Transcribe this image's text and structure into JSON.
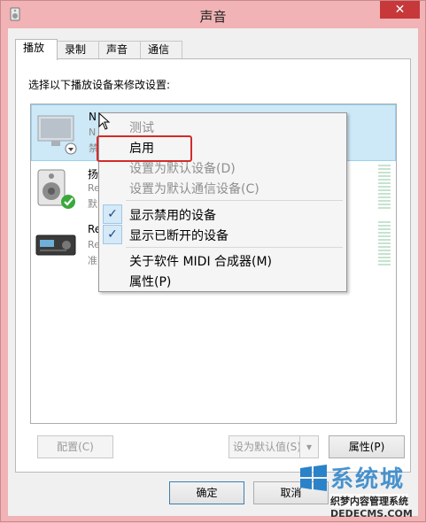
{
  "window": {
    "title": "声音",
    "close_label": "✕"
  },
  "tabs": [
    {
      "label": "播放",
      "active": true
    },
    {
      "label": "录制",
      "active": false
    },
    {
      "label": "声音",
      "active": false
    },
    {
      "label": "通信",
      "active": false
    }
  ],
  "instruction": "选择以下播放设备来修改设置:",
  "devices": [
    {
      "name": "N",
      "line2": "N",
      "line3": "禁",
      "icon": "monitor-icon",
      "status": "disabled"
    },
    {
      "name": "扬",
      "line2": "Re",
      "line3": "默",
      "icon": "speaker-icon",
      "status": "default"
    },
    {
      "name": "Re",
      "line2": "Re",
      "line3": "准",
      "icon": "receiver-icon",
      "status": "ready"
    }
  ],
  "context_menu": {
    "items": [
      {
        "label": "测试",
        "disabled": true,
        "checked": false
      },
      {
        "label": "启用",
        "disabled": false,
        "checked": false
      },
      {
        "label": "设置为默认设备(D)",
        "disabled": true,
        "checked": false
      },
      {
        "label": "设置为默认通信设备(C)",
        "disabled": true,
        "checked": false
      },
      {
        "label": "显示禁用的设备",
        "disabled": false,
        "checked": true
      },
      {
        "label": "显示已断开的设备",
        "disabled": false,
        "checked": true
      },
      {
        "label": "关于软件 MIDI 合成器(M)",
        "disabled": false,
        "checked": false
      },
      {
        "label": "属性(P)",
        "disabled": false,
        "checked": false
      }
    ]
  },
  "buttons": {
    "configure": "配置(C)",
    "set_default": "设为默认值(S)",
    "properties": "属性(P)",
    "ok": "确定",
    "cancel": "取消"
  },
  "watermark": {
    "brand": "系统城",
    "site_name": "织梦内容管理系统",
    "url": "DEDECMS.COM"
  },
  "colors": {
    "title_bar": "#f1b3b5",
    "close": "#c7383a",
    "selection": "#cde8f7",
    "highlight_box": "#d42b2b"
  }
}
